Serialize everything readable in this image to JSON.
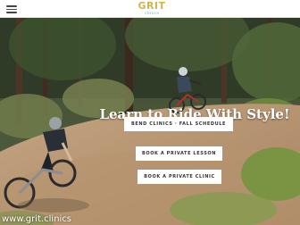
{
  "header": {
    "logo_text": "GRIT",
    "logo_sub": "clinics"
  },
  "hero": {
    "headline": "Learn to Ride With Style!",
    "buttons": [
      {
        "label": "BEND CLINICS · FALL SCHEDULE"
      },
      {
        "label": "BOOK A PRIVATE LESSON"
      },
      {
        "label": "BOOK A PRIVATE CLINIC"
      }
    ]
  },
  "watermark": "www.grit.clinics",
  "colors": {
    "logo": "#cfb54a",
    "logo_sub": "#7fb7c6",
    "button_bg": "#ffffff",
    "headline": "#ffffff"
  }
}
